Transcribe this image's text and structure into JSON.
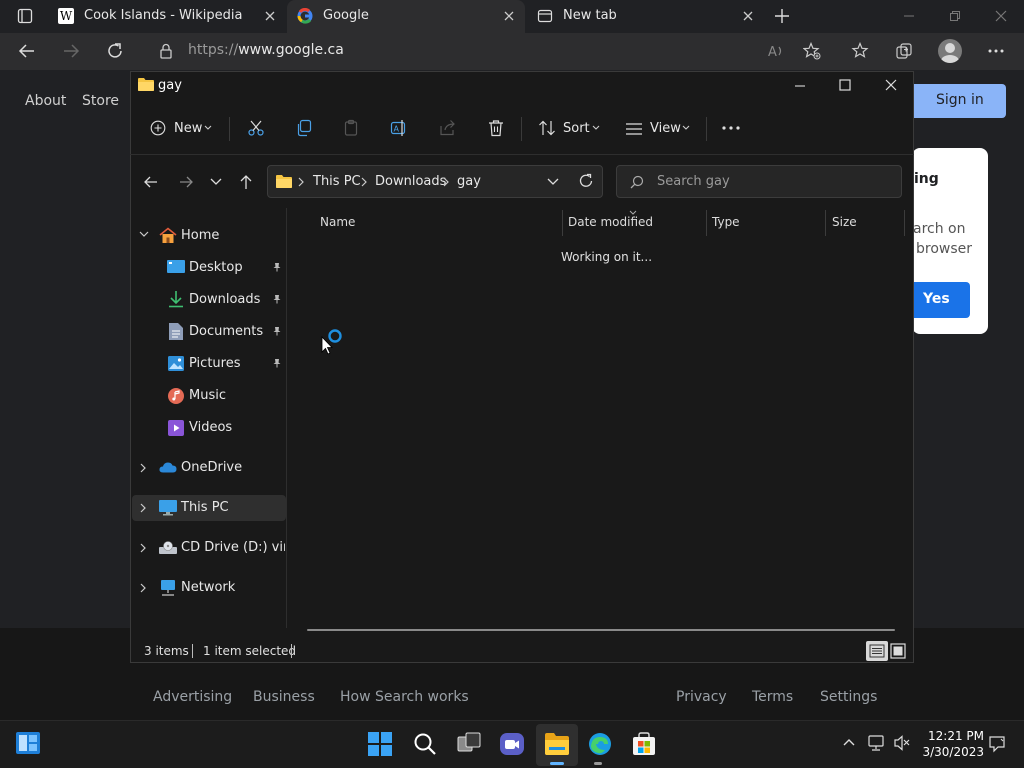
{
  "browser": {
    "tabs": [
      {
        "title": "Cook Islands - Wikipedia",
        "favicon": "wikipedia-icon"
      },
      {
        "title": "Google",
        "favicon": "google-icon",
        "active": true
      },
      {
        "title": "New tab",
        "favicon": "newtab-icon"
      }
    ],
    "url_scheme": "https://",
    "url_host": "www.google.ca"
  },
  "google": {
    "nav": {
      "about": "About",
      "store": "Store"
    },
    "sign_in": "Sign in",
    "popup": {
      "line1": "ing",
      "line2": "arch on",
      "line3": "browser",
      "yes": "Yes"
    },
    "footer": {
      "advertising": "Advertising",
      "business": "Business",
      "how_search_works": "How Search works",
      "privacy": "Privacy",
      "terms": "Terms",
      "settings": "Settings"
    }
  },
  "explorer": {
    "title": "gay",
    "toolbar": {
      "new": "New",
      "sort": "Sort",
      "view": "View"
    },
    "breadcrumb": [
      "This PC",
      "Downloads",
      "gay"
    ],
    "search_placeholder": "Search gay",
    "nav": {
      "home": "Home",
      "desktop": "Desktop",
      "downloads": "Downloads",
      "documents": "Documents",
      "pictures": "Pictures",
      "music": "Music",
      "videos": "Videos",
      "onedrive": "OneDrive",
      "thispc": "This PC",
      "cddrive": "CD Drive (D:) virtio-w",
      "network": "Network"
    },
    "columns": {
      "name": "Name",
      "date": "Date modified",
      "type": "Type",
      "size": "Size"
    },
    "status_message": "Working on it...",
    "status": {
      "items": "3 items",
      "selected": "1 item selected"
    }
  },
  "taskbar": {
    "time": "12:21 PM",
    "date": "3/30/2023"
  },
  "colors": {
    "accent": "#0078d4",
    "google_blue": "#8ab4f8",
    "folder": "#f5c542"
  }
}
